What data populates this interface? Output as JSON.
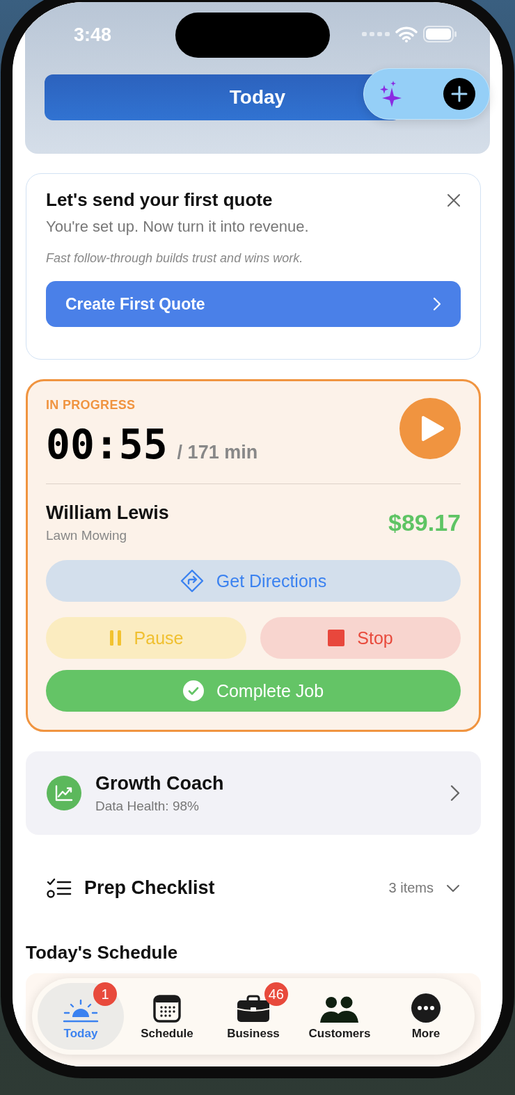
{
  "status_bar": {
    "time": "3:48"
  },
  "header": {
    "title": "Today"
  },
  "quote_prompt": {
    "title": "Let's send your first quote",
    "subtitle": "You're set up. Now turn it into revenue.",
    "hint": "Fast follow-through builds trust and wins work.",
    "button": "Create First Quote"
  },
  "active_job": {
    "status": "IN PROGRESS",
    "timer": "00:55",
    "duration": "/ 171 min",
    "customer": "William Lewis",
    "service": "Lawn Mowing",
    "amount": "$89.17",
    "actions": [
      {
        "kind": "directions",
        "label": "Get Directions"
      },
      {
        "kind": "pause",
        "label": "Pause"
      },
      {
        "kind": "stop",
        "label": "Stop"
      },
      {
        "kind": "complete",
        "label": "Complete Job"
      }
    ]
  },
  "growth_coach": {
    "title": "Growth Coach",
    "subtitle": "Data Health: 98%"
  },
  "prep_checklist": {
    "title": "Prep Checklist",
    "count": "3 items",
    "expanded": false
  },
  "schedule": {
    "heading": "Today's Schedule"
  },
  "tabs": [
    {
      "label": "Today",
      "selected": true,
      "badge": "1"
    },
    {
      "label": "Schedule",
      "selected": false
    },
    {
      "label": "Business",
      "selected": false,
      "badge": "46"
    },
    {
      "label": "Customers",
      "selected": false
    },
    {
      "label": "More",
      "selected": false
    }
  ]
}
